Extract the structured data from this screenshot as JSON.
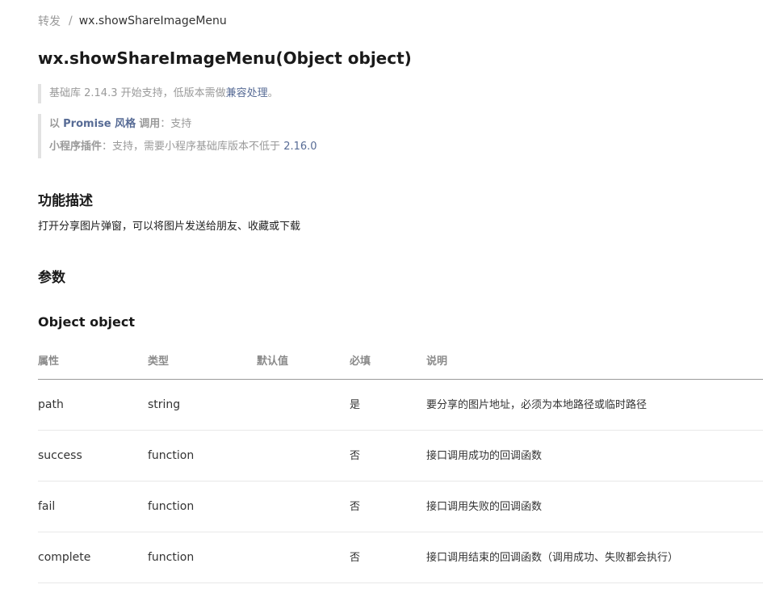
{
  "breadcrumb": {
    "parent": "转发",
    "separator": "/",
    "current": "wx.showShareImageMenu"
  },
  "title": "wx.showShareImageMenu(Object object)",
  "support_note": {
    "prefix": "基础库 2.14.3 开始支持，低版本需做",
    "link": "兼容处理",
    "suffix": "。"
  },
  "promise_note": {
    "label_prefix": "以",
    "promise_link": "Promise 风格",
    "label_suffix": "调用",
    "colon": "：",
    "value": "支持"
  },
  "plugin_note": {
    "label": "小程序插件",
    "colon": "：",
    "text": "支持，需要小程序基础库版本不低于",
    "version": "2.16.0"
  },
  "sections": {
    "description_title": "功能描述",
    "description_text": "打开分享图片弹窗，可以将图片发送给朋友、收藏或下载",
    "params_title": "参数",
    "object_title": "Object object"
  },
  "table": {
    "headers": [
      "属性",
      "类型",
      "默认值",
      "必填",
      "说明"
    ],
    "rows": [
      {
        "name": "path",
        "type": "string",
        "default": "",
        "required": "是",
        "desc": "要分享的图片地址，必须为本地路径或临时路径"
      },
      {
        "name": "success",
        "type": "function",
        "default": "",
        "required": "否",
        "desc": "接口调用成功的回调函数"
      },
      {
        "name": "fail",
        "type": "function",
        "default": "",
        "required": "否",
        "desc": "接口调用失败的回调函数"
      },
      {
        "name": "complete",
        "type": "function",
        "default": "",
        "required": "否",
        "desc": "接口调用结束的回调函数（调用成功、失败都会执行）"
      }
    ]
  },
  "colors": {
    "link": "#576b95",
    "muted": "#9a9a9a",
    "note_border": "#e2e2e2"
  }
}
